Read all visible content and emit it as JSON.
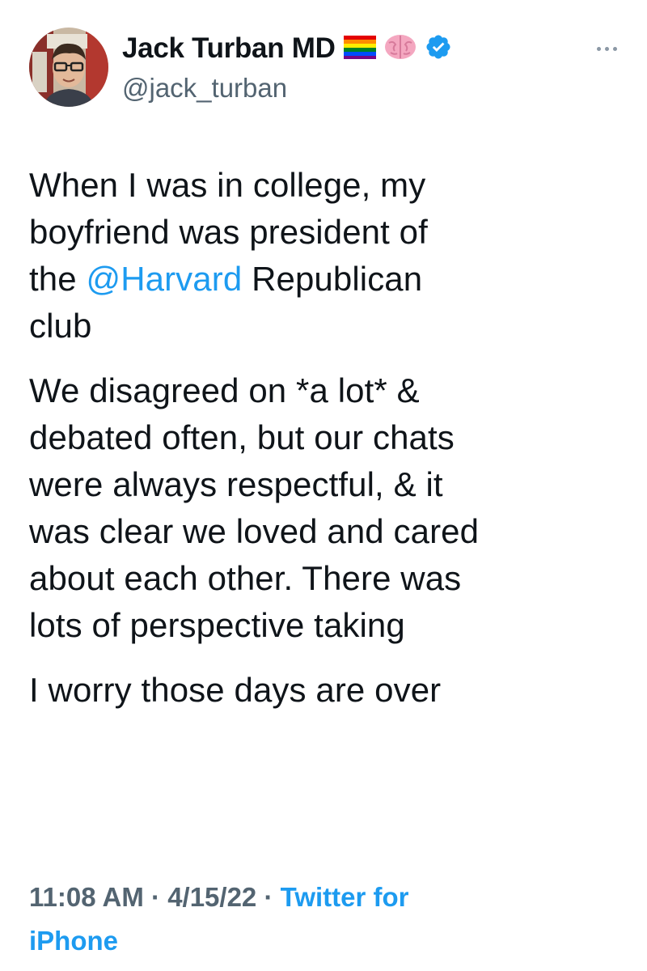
{
  "author": {
    "display_name": "Jack Turban MD",
    "handle": "@jack_turban",
    "name_emojis": [
      "rainbow-flag-icon",
      "brain-icon",
      "verified-badge-icon"
    ],
    "avatar_icon": "profile-photo"
  },
  "tweet": {
    "paragraphs": [
      {
        "lines": [
          {
            "text": "When I was in college, my"
          },
          {
            "text": "boyfriend was president of"
          },
          {
            "pre": "the ",
            "mention": "@Harvard",
            "post": " Republican"
          },
          {
            "text": "club"
          }
        ]
      },
      {
        "lines": [
          {
            "text": "We disagreed on *a lot* &"
          },
          {
            "text": "debated often, but our chats"
          },
          {
            "text": "were always respectful, & it"
          },
          {
            "text": "was clear we loved and cared"
          },
          {
            "text": "about each other. There was"
          },
          {
            "text": "lots of perspective taking"
          }
        ]
      },
      {
        "lines": [
          {
            "text": "I worry those days are over"
          }
        ]
      }
    ]
  },
  "meta": {
    "time": "11:08 AM",
    "separator": " · ",
    "date": "4/15/22",
    "source_line1": "Twitter for",
    "source_line2": "iPhone"
  },
  "colors": {
    "link": "#1d9bf0",
    "muted": "#536471",
    "text": "#0f1419",
    "verified": "#1d9bf0"
  },
  "more_icon": "more-horizontal-icon"
}
